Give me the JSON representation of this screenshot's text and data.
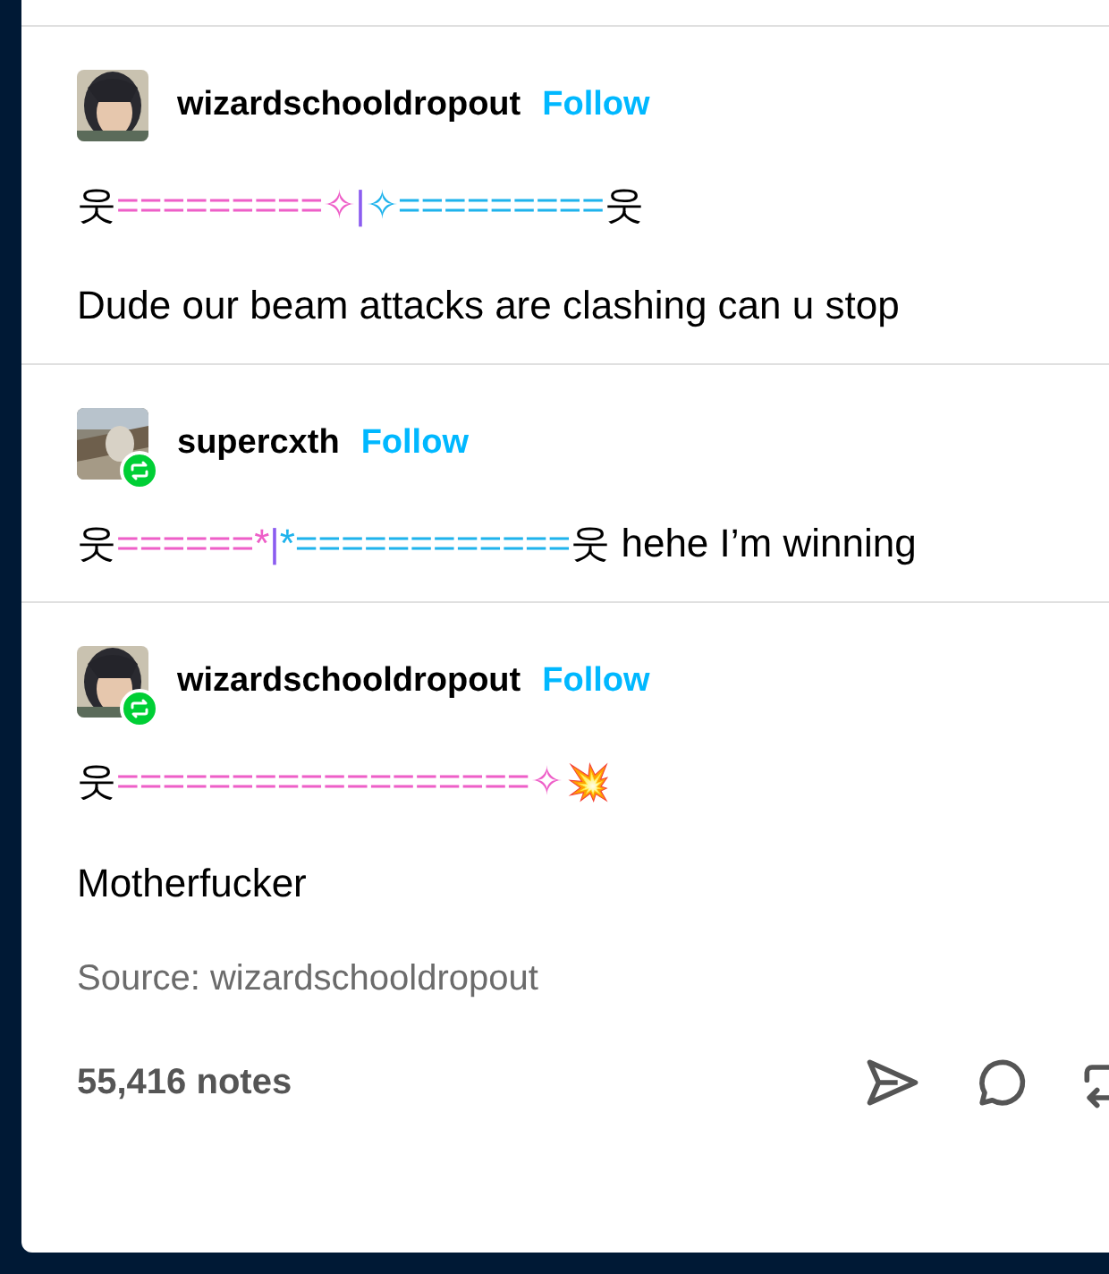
{
  "posts": [
    {
      "username": "wizardschooldropout",
      "follow": "Follow",
      "reblogged": false,
      "avatar": {
        "kind": "picture"
      },
      "lines": [
        {
          "kind": "beam",
          "segments": [
            {
              "text": "웃",
              "color": "#000000"
            },
            {
              "text": "=========✧",
              "color": "#ee5fc8"
            },
            {
              "text": "|",
              "color": "#8b5cf0"
            },
            {
              "text": "✧=========",
              "color": "#1fb3ec"
            },
            {
              "text": "웃",
              "color": "#000000"
            }
          ]
        },
        {
          "kind": "text",
          "text": "Dude our beam attacks are clashing can u stop"
        }
      ]
    },
    {
      "username": "supercxth",
      "follow": "Follow",
      "reblogged": true,
      "avatar": {
        "kind": "picture"
      },
      "lines": [
        {
          "kind": "beam",
          "segments": [
            {
              "text": "웃",
              "color": "#000000"
            },
            {
              "text": "======*",
              "color": "#ee5fc8"
            },
            {
              "text": "|",
              "color": "#8b5cf0"
            },
            {
              "text": "*============",
              "color": "#1fb3ec"
            },
            {
              "text": "웃 hehe I’m winning",
              "color": "#000000"
            }
          ]
        }
      ]
    },
    {
      "username": "wizardschooldropout",
      "follow": "Follow",
      "reblogged": true,
      "avatar": {
        "kind": "picture"
      },
      "lines": [
        {
          "kind": "beam",
          "segments": [
            {
              "text": "웃",
              "color": "#000000"
            },
            {
              "text": "==================✧",
              "color": "#ee5fc8"
            },
            {
              "text": "💥",
              "kind": "emoji"
            }
          ]
        },
        {
          "kind": "text",
          "text": "Motherfucker"
        }
      ]
    }
  ],
  "source": "Source: wizardschooldropout",
  "notes": "55,416 notes"
}
